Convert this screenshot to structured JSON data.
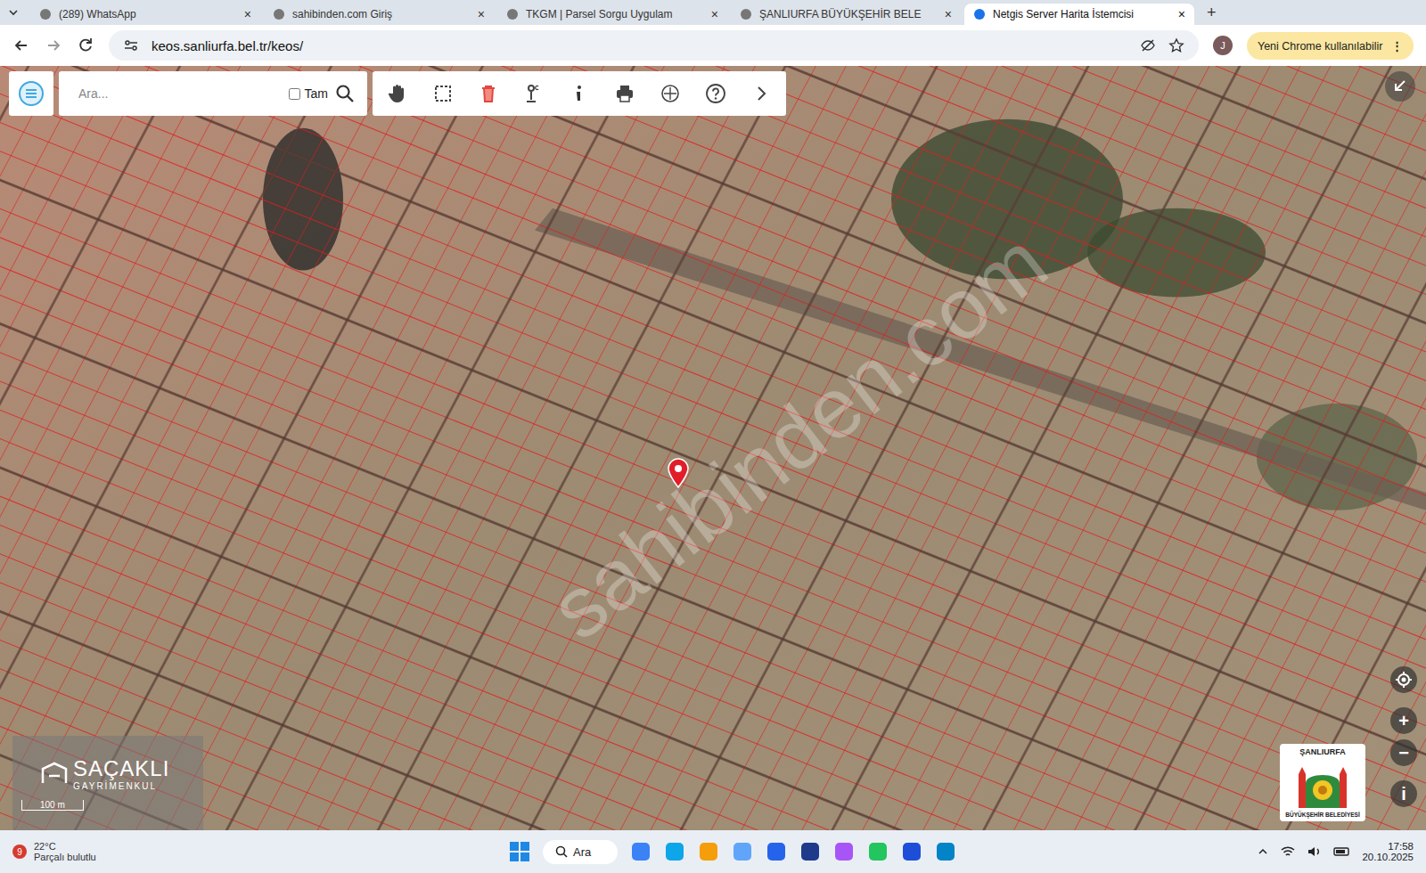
{
  "browser": {
    "tabs": [
      {
        "label": "(289) WhatsApp",
        "selected": false
      },
      {
        "label": "sahibinden.com Giriş",
        "selected": false
      },
      {
        "label": "TKGM | Parsel Sorgu Uygulam",
        "selected": false
      },
      {
        "label": "ŞANLIURFA BÜYÜKŞEHİR BELE",
        "selected": false
      },
      {
        "label": "Netgis Server Harita İstemcisi",
        "selected": true
      }
    ],
    "tab_close": "×",
    "new_tab": "+",
    "address": "keos.sanliurfa.bel.tr/keos/",
    "profile": "J",
    "update_button": "Yeni Chrome kullanılabilir",
    "menu": "⋮"
  },
  "map_toolbar": {
    "search_placeholder": "Ara...",
    "full_match": {
      "label": "Tam",
      "checked": false
    }
  },
  "map": {
    "watermark": "sahibinden.com",
    "agency_logo": {
      "name": "SAÇAKLI",
      "subtitle": "GAYRİMENKUL"
    },
    "municipality_logo": {
      "top": "ŞANLIURFA",
      "bottom": "BÜYÜKŞEHİR BELEDİYESİ"
    },
    "scale": "100 m",
    "zoom_in": "+",
    "zoom_out": "−",
    "info": "i"
  },
  "taskbar": {
    "weather": {
      "badge": "9",
      "temperature": "22°C",
      "condition": "Parçalı bulutlu"
    },
    "search": "Ara",
    "time": "17:58",
    "date": "20.10.2025"
  }
}
